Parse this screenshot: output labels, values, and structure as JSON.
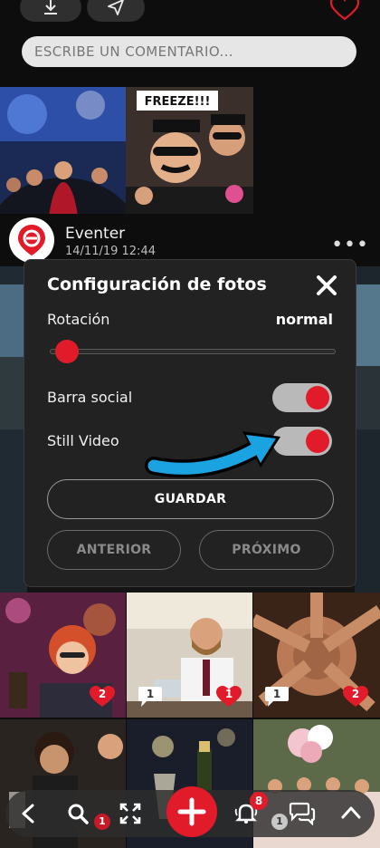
{
  "comment_input": {
    "placeholder": "ESCRIBE UN COMENTARIO..."
  },
  "post": {
    "author": "Eventer",
    "date": "14/11/19 12:44",
    "more": "•••"
  },
  "photo_sign": "FREEZE!!!",
  "modal": {
    "title": "Configuración de fotos",
    "rotation_label": "Rotación",
    "rotation_value": "normal",
    "rotation_level": 0,
    "social_bar_label": "Barra social",
    "social_bar_on": true,
    "still_video_label": "Still Video",
    "still_video_on": true,
    "save_label": "GUARDAR",
    "prev_label": "ANTERIOR",
    "next_label": "PRÓXIMO"
  },
  "grid_badges": {
    "row1": [
      {
        "likes": "2"
      },
      {
        "comments": "1",
        "likes": "1"
      },
      {
        "comments": "1",
        "likes": "2"
      }
    ]
  },
  "bottom_nav": {
    "search_badge": "1",
    "notifications_count": "8",
    "chat_badge": "1",
    "icons": [
      "back-icon",
      "search-icon",
      "expand-icon",
      "add-icon",
      "bell-icon",
      "chat-icon",
      "chevron-up-icon"
    ]
  },
  "colors": {
    "accent": "#e11b2a",
    "background": "#0d0d0d",
    "modal": "#222222",
    "annotation_arrow": "#1aa3e0"
  }
}
